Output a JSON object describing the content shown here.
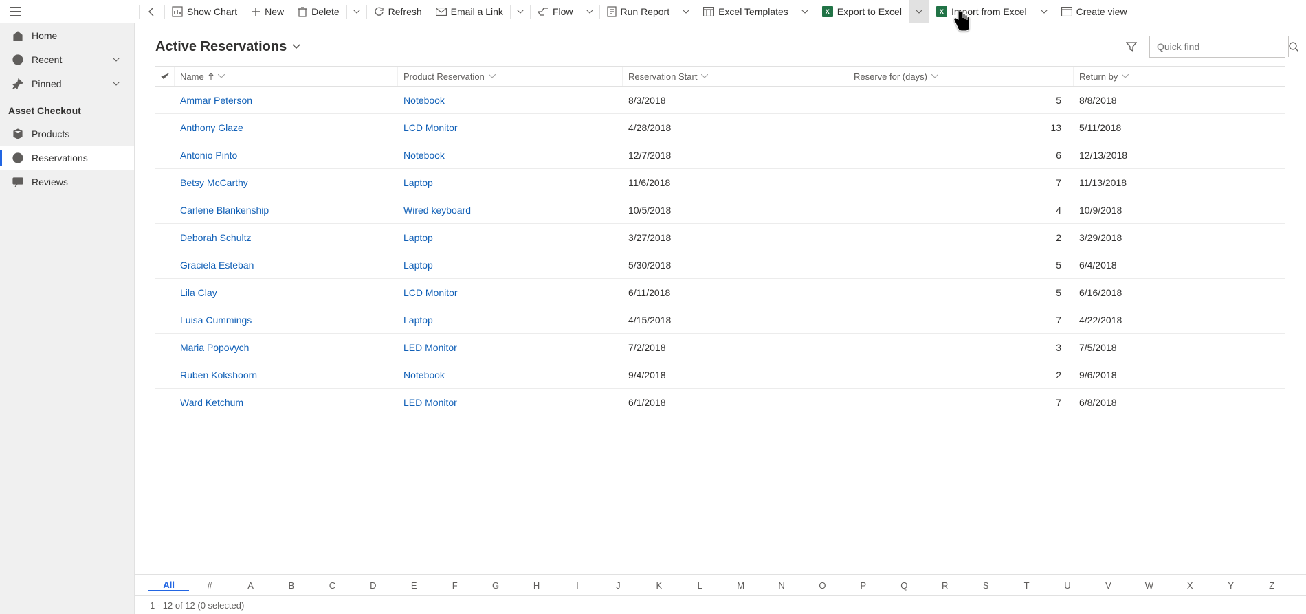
{
  "toolbar": {
    "show_chart": "Show Chart",
    "new": "New",
    "delete": "Delete",
    "refresh": "Refresh",
    "email_a_link": "Email a Link",
    "flow": "Flow",
    "run_report": "Run Report",
    "excel_templates": "Excel Templates",
    "export_to_excel": "Export to Excel",
    "import_from_excel": "Import from Excel",
    "create_view": "Create view"
  },
  "sidebar": {
    "home": "Home",
    "recent": "Recent",
    "pinned": "Pinned",
    "section": "Asset Checkout",
    "products": "Products",
    "reservations": "Reservations",
    "reviews": "Reviews"
  },
  "view": {
    "title": "Active Reservations",
    "quick_find_placeholder": "Quick find"
  },
  "columns": {
    "name": "Name",
    "product": "Product Reservation",
    "start": "Reservation Start",
    "days": "Reserve for (days)",
    "return_by": "Return by"
  },
  "rows": [
    {
      "name": "Ammar Peterson",
      "product": "Notebook",
      "start": "8/3/2018",
      "days": "5",
      "return_by": "8/8/2018"
    },
    {
      "name": "Anthony Glaze",
      "product": "LCD Monitor",
      "start": "4/28/2018",
      "days": "13",
      "return_by": "5/11/2018"
    },
    {
      "name": "Antonio Pinto",
      "product": "Notebook",
      "start": "12/7/2018",
      "days": "6",
      "return_by": "12/13/2018"
    },
    {
      "name": "Betsy McCarthy",
      "product": "Laptop",
      "start": "11/6/2018",
      "days": "7",
      "return_by": "11/13/2018"
    },
    {
      "name": "Carlene Blankenship",
      "product": "Wired keyboard",
      "start": "10/5/2018",
      "days": "4",
      "return_by": "10/9/2018"
    },
    {
      "name": "Deborah Schultz",
      "product": "Laptop",
      "start": "3/27/2018",
      "days": "2",
      "return_by": "3/29/2018"
    },
    {
      "name": "Graciela Esteban",
      "product": "Laptop",
      "start": "5/30/2018",
      "days": "5",
      "return_by": "6/4/2018"
    },
    {
      "name": "Lila Clay",
      "product": "LCD Monitor",
      "start": "6/11/2018",
      "days": "5",
      "return_by": "6/16/2018"
    },
    {
      "name": "Luisa Cummings",
      "product": "Laptop",
      "start": "4/15/2018",
      "days": "7",
      "return_by": "4/22/2018"
    },
    {
      "name": "Maria Popovych",
      "product": "LED Monitor",
      "start": "7/2/2018",
      "days": "3",
      "return_by": "7/5/2018"
    },
    {
      "name": "Ruben Kokshoorn",
      "product": "Notebook",
      "start": "9/4/2018",
      "days": "2",
      "return_by": "9/6/2018"
    },
    {
      "name": "Ward Ketchum",
      "product": "LED Monitor",
      "start": "6/1/2018",
      "days": "7",
      "return_by": "6/8/2018"
    }
  ],
  "alpha": [
    "All",
    "#",
    "A",
    "B",
    "C",
    "D",
    "E",
    "F",
    "G",
    "H",
    "I",
    "J",
    "K",
    "L",
    "M",
    "N",
    "O",
    "P",
    "Q",
    "R",
    "S",
    "T",
    "U",
    "V",
    "W",
    "X",
    "Y",
    "Z"
  ],
  "footer": "1 - 12 of 12 (0 selected)"
}
